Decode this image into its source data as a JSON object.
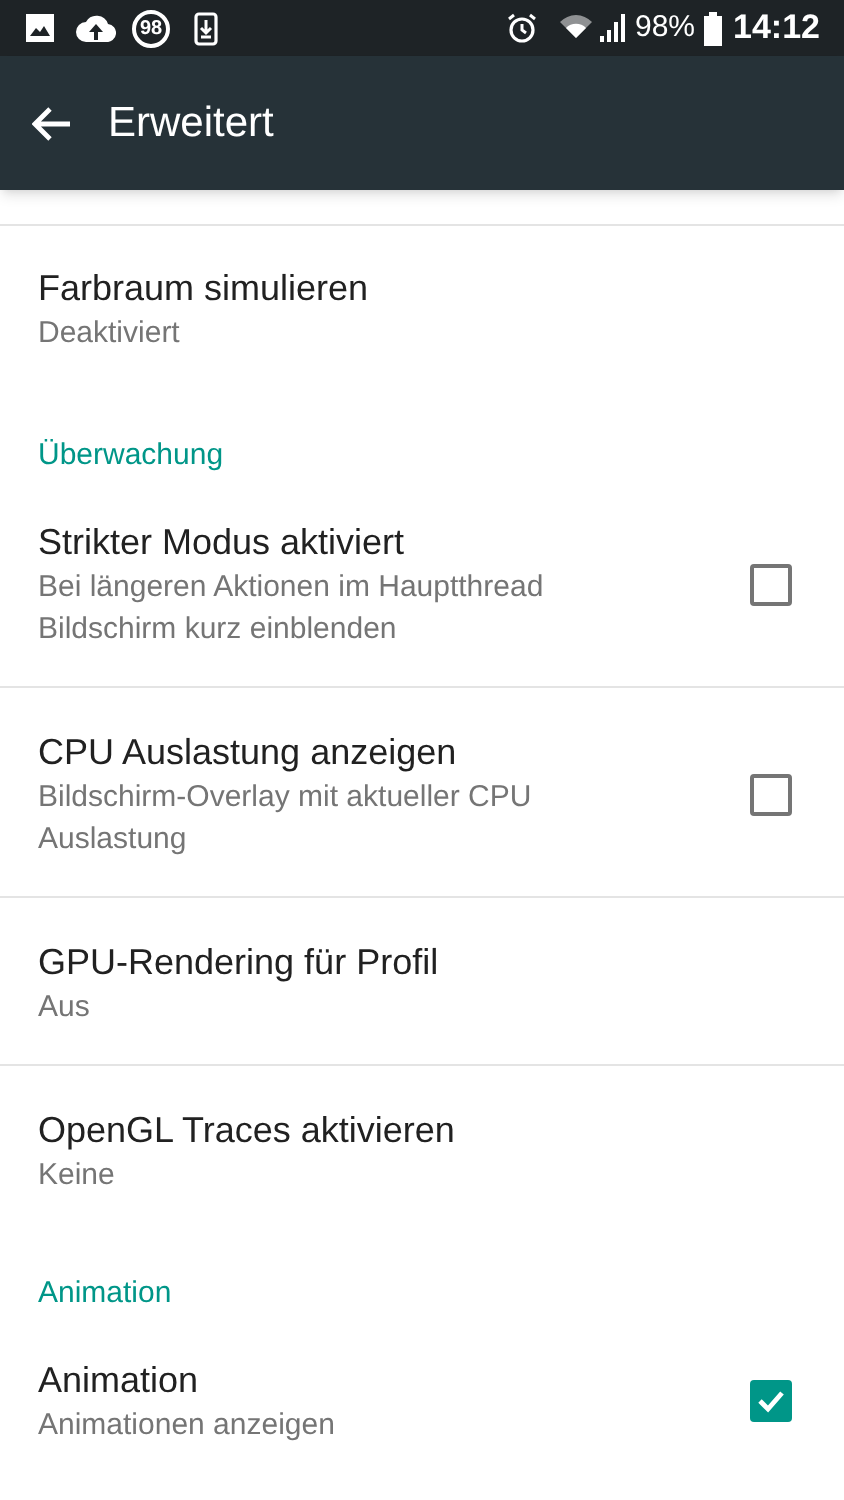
{
  "status_bar": {
    "badge_count": "98",
    "battery": "98%",
    "time": "14:12"
  },
  "app_bar": {
    "title": "Erweitert"
  },
  "sections": [
    {
      "items": [
        {
          "kind": "text",
          "title": "Farbraum simulieren",
          "summary": "Deaktiviert"
        }
      ]
    },
    {
      "header": "Überwachung",
      "items": [
        {
          "kind": "checkbox",
          "title": "Strikter Modus aktiviert",
          "summary": "Bei längeren Aktionen im Hauptthread Bildschirm kurz einblenden",
          "checked": false
        },
        {
          "kind": "checkbox",
          "title": "CPU Auslastung anzeigen",
          "summary": "Bildschirm-Overlay mit aktueller CPU Auslastung",
          "checked": false
        },
        {
          "kind": "text",
          "title": "GPU-Rendering für Profil",
          "summary": "Aus"
        },
        {
          "kind": "text",
          "title": "OpenGL Traces aktivieren",
          "summary": "Keine"
        }
      ]
    },
    {
      "header": "Animation",
      "items": [
        {
          "kind": "checkbox",
          "title": "Animation",
          "summary": "Animationen anzeigen",
          "checked": true
        }
      ]
    }
  ]
}
